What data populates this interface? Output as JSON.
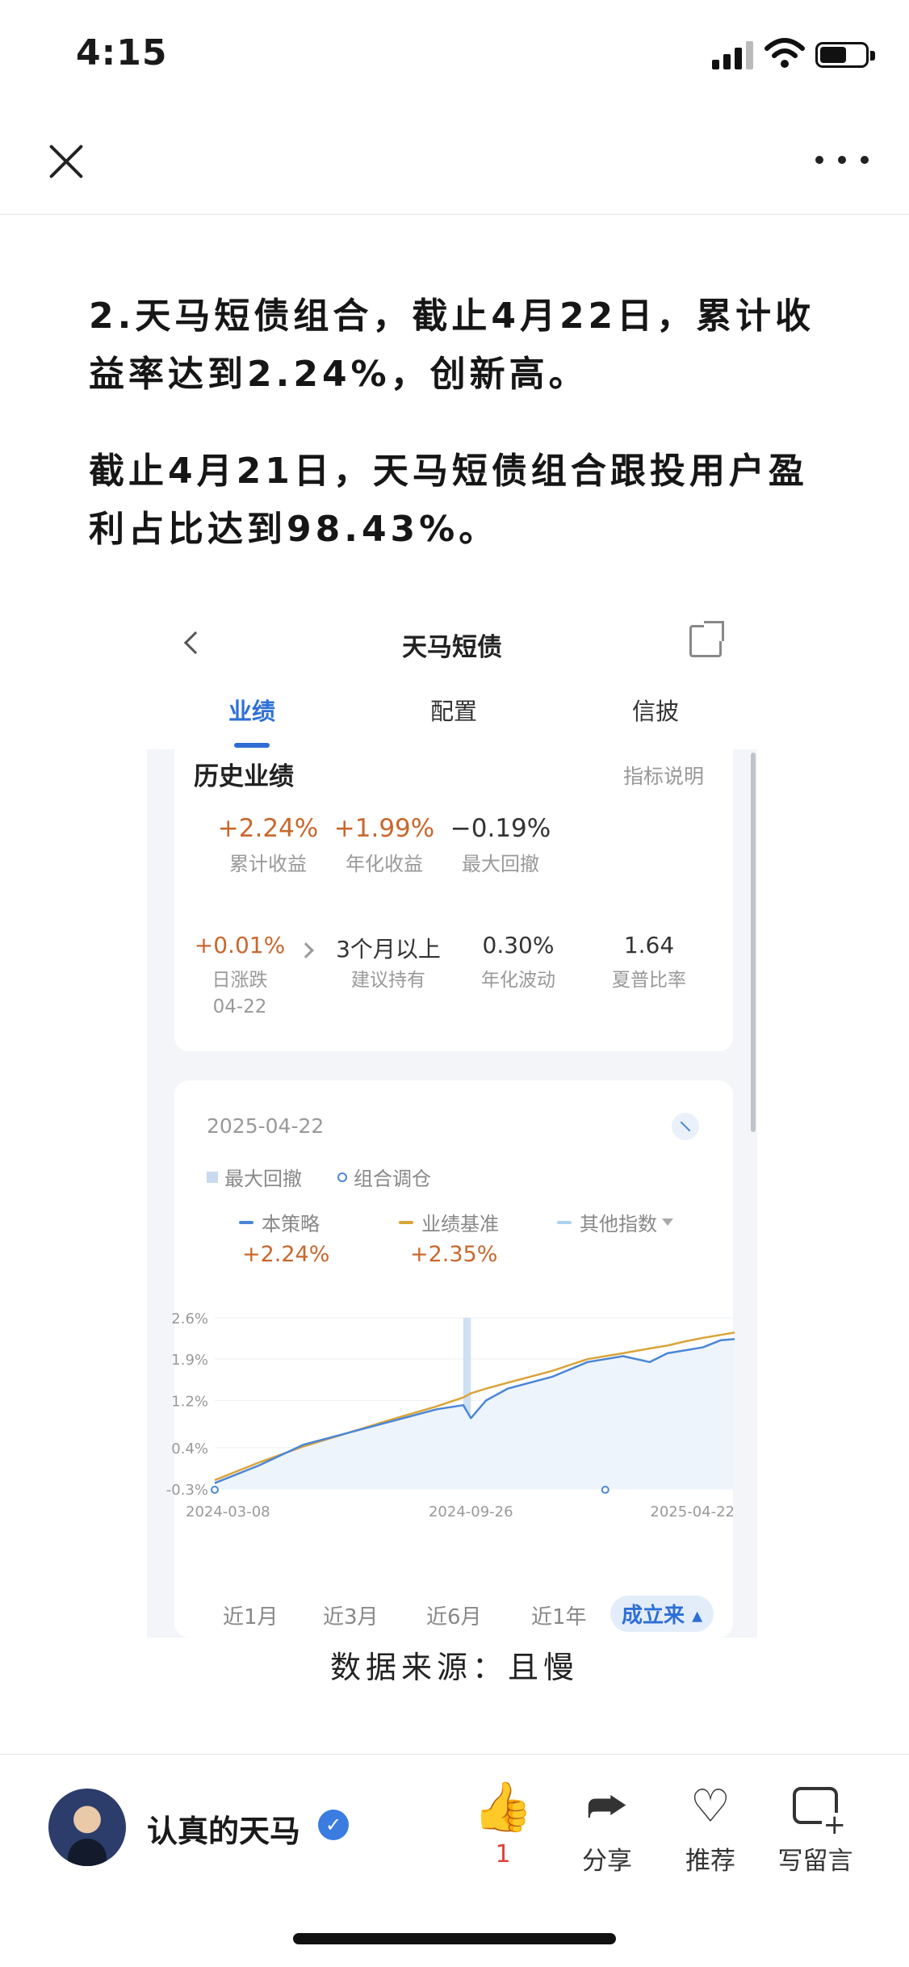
{
  "status_bar": {
    "time": "4:15",
    "battery_level": 0.6
  },
  "nav": {
    "close_icon": "close-icon",
    "more_icon": "more-horizontal-icon"
  },
  "article": {
    "paragraph1": "2.天马短债组合，截止4月22日，累计收益率达到2.24%，创新高。",
    "paragraph2": "截止4月21日，天马短债组合跟投用户盈利占比达到98.43%。",
    "source": "数据来源：且慢"
  },
  "screenshot": {
    "title": "天马短债",
    "tabs": [
      {
        "label": "业绩",
        "active": true
      },
      {
        "label": "配置",
        "active": false
      },
      {
        "label": "信披",
        "active": false
      }
    ],
    "history": {
      "title": "历史业绩",
      "link": "指标说明",
      "metrics": [
        {
          "value": "+2.24%",
          "label": "累计收益"
        },
        {
          "value": "+1.99%",
          "label": "年化收益"
        },
        {
          "value": "−0.19%",
          "label": "最大回撤"
        }
      ],
      "metrics2": [
        {
          "value": "+0.01%",
          "label": "日涨跌",
          "sub": "04-22"
        },
        {
          "value": "3个月以上",
          "label": "建议持有"
        },
        {
          "value": "0.30%",
          "label": "年化波动"
        },
        {
          "value": "1.64",
          "label": "夏普比率"
        }
      ]
    },
    "chart_panel": {
      "date": "2025-04-22",
      "legend1": {
        "drawdown": "最大回撤",
        "rebalance": "组合调仓"
      },
      "series_legend": [
        {
          "name": "本策略",
          "value": "+2.24%",
          "color": "#4a86d8"
        },
        {
          "name": "业绩基准",
          "value": "+2.35%",
          "color": "#d9a43a"
        },
        {
          "name": "其他指数",
          "value": "",
          "color": "#a9d4ef"
        }
      ],
      "ranges": [
        {
          "label": "近1月",
          "active": false
        },
        {
          "label": "近3月",
          "active": false
        },
        {
          "label": "近6月",
          "active": false
        },
        {
          "label": "近1年",
          "active": false
        },
        {
          "label": "成立来",
          "active": true
        }
      ]
    }
  },
  "chart_data": {
    "type": "line",
    "ytick_labels": [
      "2.6%",
      "1.9%",
      "1.2%",
      "0.4%",
      "-0.3%"
    ],
    "ytick_values": [
      2.6,
      1.9,
      1.2,
      0.4,
      -0.3
    ],
    "xtick_labels": [
      "2024-03-08",
      "2024-09-26",
      "2025-04-22"
    ],
    "ylim": [
      -0.3,
      2.6
    ],
    "x": [
      "2024-03-08",
      "2024-04-12",
      "2024-05-17",
      "2024-06-21",
      "2024-07-26",
      "2024-08-30",
      "2024-09-20",
      "2024-09-26",
      "2024-10-08",
      "2024-10-25",
      "2024-11-29",
      "2024-12-27",
      "2025-01-24",
      "2025-02-14",
      "2025-02-28",
      "2025-03-14",
      "2025-03-28",
      "2025-04-11",
      "2025-04-22"
    ],
    "series": [
      {
        "name": "本策略",
        "color": "#4a86d8",
        "values": [
          -0.2,
          0.1,
          0.45,
          0.65,
          0.85,
          1.05,
          1.12,
          0.9,
          1.2,
          1.4,
          1.6,
          1.85,
          1.95,
          1.85,
          2.0,
          2.05,
          2.1,
          2.22,
          2.24
        ]
      },
      {
        "name": "业绩基准",
        "color": "#d9a43a",
        "values": [
          -0.15,
          0.15,
          0.42,
          0.65,
          0.88,
          1.1,
          1.25,
          1.32,
          1.4,
          1.5,
          1.7,
          1.9,
          2.0,
          2.08,
          2.13,
          2.2,
          2.26,
          2.31,
          2.35
        ]
      }
    ],
    "rebalance_markers": [
      "2024-03-08",
      "2025-01-10"
    ],
    "drawdown_band": [
      "2024-09-20",
      "2024-09-26"
    ]
  },
  "bottom_bar": {
    "author": "认真的天马",
    "verified_icon": "verified-badge-icon",
    "actions": [
      {
        "icon": "thumb-up-icon",
        "label": "1"
      },
      {
        "icon": "share-icon",
        "label": "分享"
      },
      {
        "icon": "heart-icon",
        "label": "推荐"
      },
      {
        "icon": "comment-add-icon",
        "label": "写留言"
      }
    ]
  }
}
